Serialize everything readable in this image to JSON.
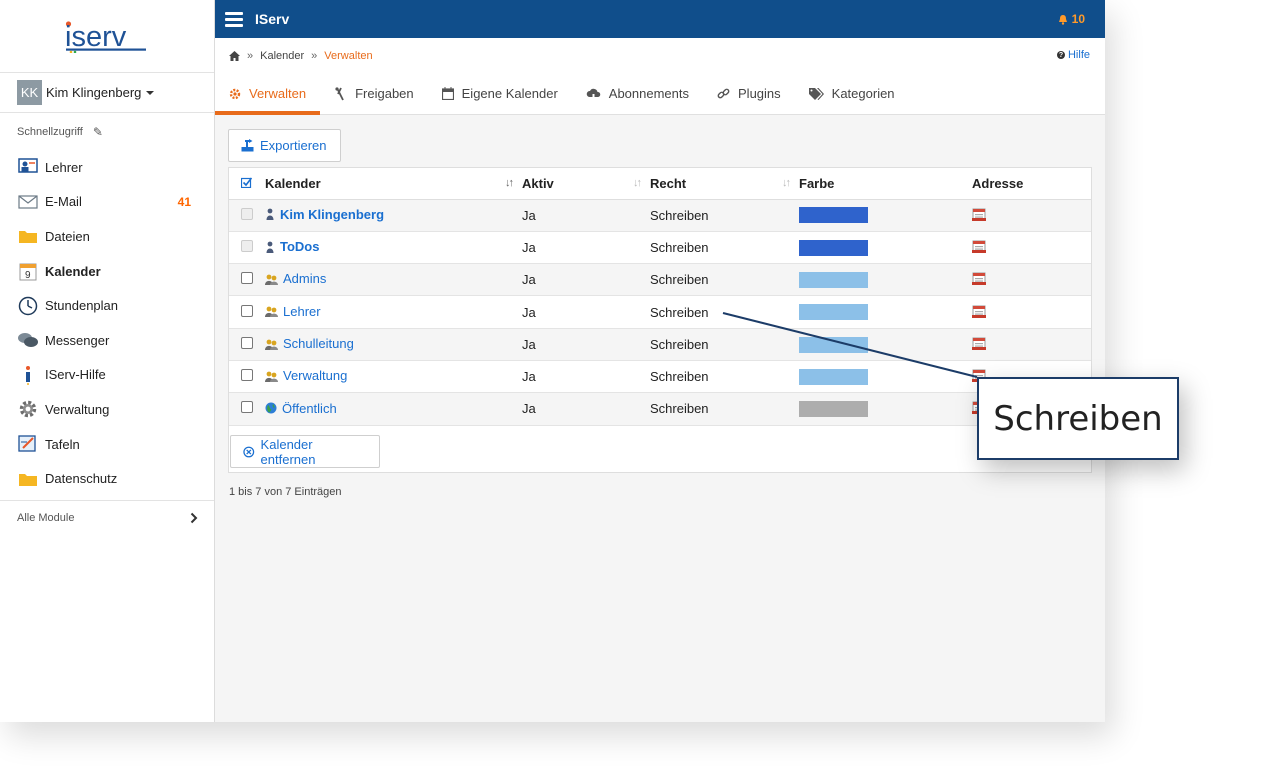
{
  "app": {
    "title": "IServ",
    "logo_text": "iserv",
    "notifications": "10"
  },
  "user": {
    "initials": "KK",
    "name": "Kim Klingenberg"
  },
  "sidebar": {
    "section_label": "Schnellzugriff",
    "items": [
      {
        "label": "Lehrer",
        "icon": "teacher-icon",
        "count": ""
      },
      {
        "label": "E-Mail",
        "icon": "mail-icon",
        "count": "41"
      },
      {
        "label": "Dateien",
        "icon": "folder-icon",
        "count": ""
      },
      {
        "label": "Kalender",
        "icon": "calendar-icon",
        "count": ""
      },
      {
        "label": "Stundenplan",
        "icon": "clock-icon",
        "count": ""
      },
      {
        "label": "Messenger",
        "icon": "chat-icon",
        "count": ""
      },
      {
        "label": "IServ-Hilfe",
        "icon": "help-icon",
        "count": ""
      },
      {
        "label": "Verwaltung",
        "icon": "gear-icon",
        "count": ""
      },
      {
        "label": "Tafeln",
        "icon": "board-icon",
        "count": ""
      },
      {
        "label": "Datenschutz",
        "icon": "folder-icon",
        "count": ""
      }
    ],
    "all_modules": "Alle Module"
  },
  "breadcrumb": {
    "sep": "»",
    "parent": "Kalender",
    "current": "Verwalten",
    "help": "Hilfe"
  },
  "tabs": [
    {
      "label": "Verwalten",
      "icon": "gear-icon"
    },
    {
      "label": "Freigaben",
      "icon": "share-icon"
    },
    {
      "label": "Eigene Kalender",
      "icon": "calendar-icon"
    },
    {
      "label": "Abonnements",
      "icon": "cloud-download-icon"
    },
    {
      "label": "Plugins",
      "icon": "link-icon"
    },
    {
      "label": "Kategorien",
      "icon": "tags-icon"
    }
  ],
  "toolbar": {
    "export_label": "Exportieren",
    "remove_label": "Kalender entfernen"
  },
  "table": {
    "headers": {
      "calendar": "Kalender",
      "active": "Aktiv",
      "right": "Recht",
      "color": "Farbe",
      "address": "Adresse"
    },
    "rows": [
      {
        "name": "Kim Klingenberg",
        "active": "Ja",
        "right": "Schreiben",
        "color": "#2f63cc",
        "type": "user",
        "disabled": true
      },
      {
        "name": "ToDos",
        "active": "Ja",
        "right": "Schreiben",
        "color": "#2f63cc",
        "type": "user",
        "disabled": true
      },
      {
        "name": "Admins",
        "active": "Ja",
        "right": "Schreiben",
        "color": "#8cc0e8",
        "type": "group",
        "disabled": false
      },
      {
        "name": "Lehrer",
        "active": "Ja",
        "right": "Schreiben",
        "color": "#8cc0e8",
        "type": "group",
        "disabled": false
      },
      {
        "name": "Schulleitung",
        "active": "Ja",
        "right": "Schreiben",
        "color": "#8cc0e8",
        "type": "group",
        "disabled": false
      },
      {
        "name": "Verwaltung",
        "active": "Ja",
        "right": "Schreiben",
        "color": "#8cc0e8",
        "type": "group",
        "disabled": false
      },
      {
        "name": "Öffentlich",
        "active": "Ja",
        "right": "Schreiben",
        "color": "#adadad",
        "type": "globe",
        "disabled": false
      }
    ]
  },
  "footer_info": "1 bis 7 von 7 Einträgen",
  "callout": {
    "text": "Schreiben"
  }
}
